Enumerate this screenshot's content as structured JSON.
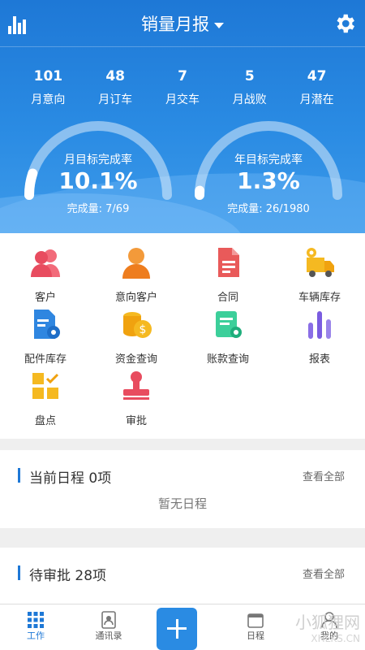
{
  "header": {
    "title": "销量月报",
    "stats": [
      {
        "value": "101",
        "label": "月意向"
      },
      {
        "value": "48",
        "label": "月订车"
      },
      {
        "value": "7",
        "label": "月交车"
      },
      {
        "value": "5",
        "label": "月战败"
      },
      {
        "value": "47",
        "label": "月潜在"
      }
    ],
    "gauges": [
      {
        "title": "月目标完成率",
        "value": "10.1%",
        "fraction": 0.101,
        "sub": "完成量: 7/69"
      },
      {
        "title": "年目标完成率",
        "value": "1.3%",
        "fraction": 0.013,
        "sub": "完成量: 26/1980"
      }
    ]
  },
  "menu": {
    "items": [
      {
        "label": "客户",
        "icon": "customer-icon"
      },
      {
        "label": "意向客户",
        "icon": "intent-customer-icon"
      },
      {
        "label": "合同",
        "icon": "contract-icon"
      },
      {
        "label": "车辆库存",
        "icon": "vehicle-stock-icon"
      },
      {
        "label": "配件库存",
        "icon": "parts-stock-icon"
      },
      {
        "label": "资金查询",
        "icon": "funds-query-icon"
      },
      {
        "label": "账款查询",
        "icon": "account-query-icon"
      },
      {
        "label": "报表",
        "icon": "report-icon"
      },
      {
        "label": "盘点",
        "icon": "inventory-check-icon"
      },
      {
        "label": "审批",
        "icon": "approval-stamp-icon"
      }
    ]
  },
  "schedule": {
    "title": "当前日程 0项",
    "more": "查看全部",
    "empty": "暂无日程"
  },
  "pending": {
    "title": "待审批 28项",
    "more": "查看全部"
  },
  "nav": {
    "items": [
      {
        "label": "工作",
        "icon": "grid-icon"
      },
      {
        "label": "通讯录",
        "icon": "contacts-icon"
      },
      {
        "label": "日程",
        "icon": "calendar-icon"
      },
      {
        "label": "我的",
        "icon": "profile-icon"
      }
    ]
  },
  "watermark": {
    "cn": "小狐狸网",
    "en": "XHLKS.CN"
  },
  "colors": {
    "primary": "#1e78d6",
    "accent": "#2a8be3"
  }
}
